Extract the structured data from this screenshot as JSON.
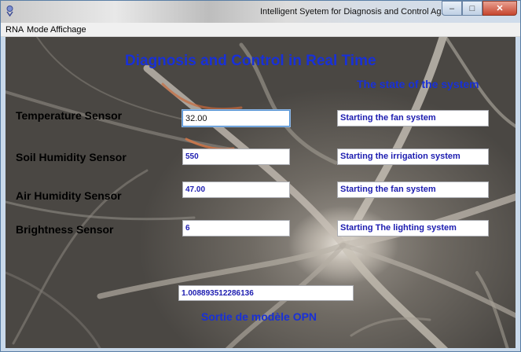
{
  "window": {
    "title": "Intelligent Syetem for Diagnosis and Control Agricultural",
    "buttons": {
      "minimize": "–",
      "maximize": "□",
      "close": "✕"
    }
  },
  "menu": [
    "RNA",
    "Mode",
    "Affichage"
  ],
  "main": {
    "heading": "Diagnosis and Control in Real Time",
    "state_title": "The state of the system",
    "sensors": [
      {
        "label": "Temperature Sensor",
        "value": "32.00",
        "status": "Starting the fan system"
      },
      {
        "label": "Soil Humidity Sensor",
        "value": "550",
        "status": "Starting the irrigation system"
      },
      {
        "label": "Air Humidity Sensor",
        "value": "47.00",
        "status": "Starting the fan system"
      },
      {
        "label": "Brightness Sensor",
        "value": "6",
        "status": "Starting The lighting system"
      }
    ],
    "output_value": "1.008893512286136",
    "output_label": "Sortie de modèle OPN"
  },
  "colors": {
    "accent": "#1830d8",
    "field_text": "#1c1cb0"
  }
}
